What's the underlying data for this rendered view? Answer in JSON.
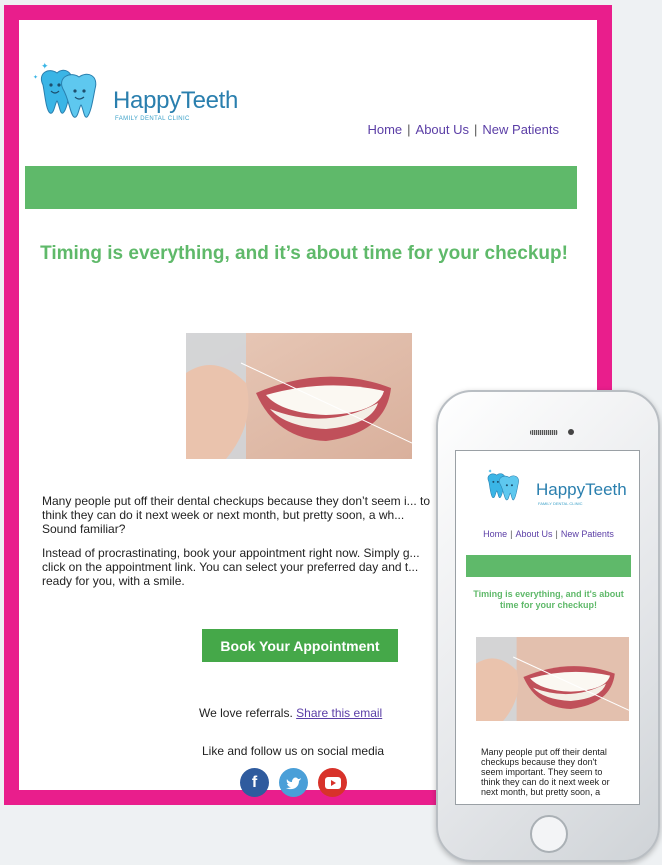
{
  "brand": {
    "name": "HappyTeeth",
    "tagline": "FAMILY DENTAL CLINIC"
  },
  "nav": {
    "items": [
      "Home",
      "About Us",
      "New Patients"
    ]
  },
  "headline": "Timing is everything, and it’s about time for your checkup!",
  "body": {
    "p1": "Many people put off their dental checkups because they don’t seem i... to think they can do it next week or next month, but pretty soon, a wh... Sound familiar?",
    "p2": "Instead of procrastinating, book your appointment right now. Simply g... click on the appointment link. You can select your preferred day and t... ready for you, with a smile."
  },
  "cta": {
    "label": "Book Your Appointment"
  },
  "referral": {
    "text": "We love referrals.",
    "link": "Share this email"
  },
  "social": {
    "label": "Like and follow us on social media",
    "icons": [
      "facebook-icon",
      "twitter-icon",
      "youtube-icon"
    ]
  },
  "mobile": {
    "headline": "Timing is everything, and it's about time for your checkup!",
    "body": "Many people put off their dental checkups because they don't seem important. They seem to think they can do it next week or next month, but pretty soon, a"
  },
  "colors": {
    "frame": "#e91e8c",
    "accent": "#5fb96a",
    "cta": "#45a849",
    "link": "#5b3ea6",
    "brand": "#2a7fae"
  }
}
